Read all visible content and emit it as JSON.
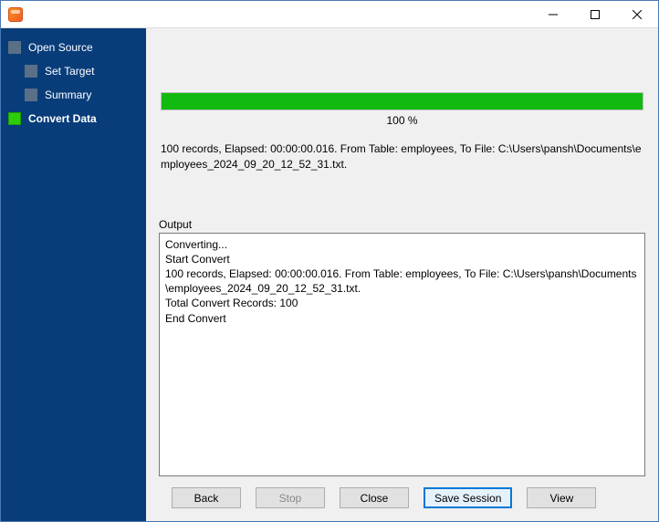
{
  "window": {
    "title": ""
  },
  "sidebar": {
    "items": [
      {
        "label": "Open Source",
        "sub": false,
        "active": false
      },
      {
        "label": "Set Target",
        "sub": true,
        "active": false
      },
      {
        "label": "Summary",
        "sub": true,
        "active": false
      },
      {
        "label": "Convert Data",
        "sub": false,
        "active": true
      }
    ]
  },
  "progress": {
    "percent": 100,
    "label": "100 %"
  },
  "summary": "100 records,    Elapsed: 00:00:00.016.    From Table: employees,    To File: C:\\Users\\pansh\\Documents\\employees_2024_09_20_12_52_31.txt.",
  "output": {
    "label": "Output",
    "lines": [
      "Converting...",
      "Start Convert",
      "100 records,    Elapsed: 00:00:00.016.    From Table: employees,    To File: C:\\Users\\pansh\\Documents\\employees_2024_09_20_12_52_31.txt.",
      "Total Convert Records: 100",
      "End Convert"
    ]
  },
  "buttons": {
    "back": "Back",
    "stop": "Stop",
    "close": "Close",
    "save_session": "Save Session",
    "view": "View"
  }
}
